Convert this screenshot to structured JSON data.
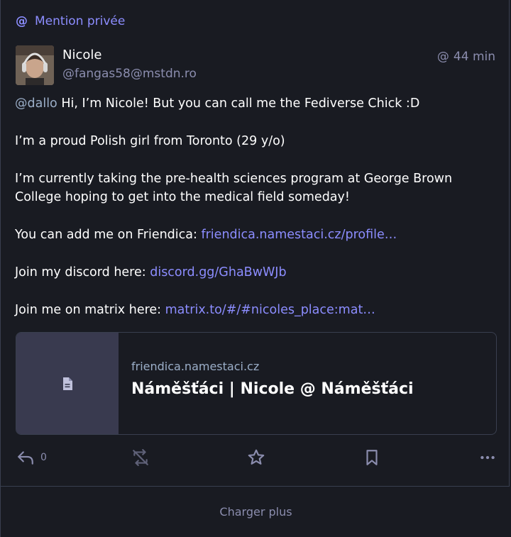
{
  "prepend": {
    "icon": "at-icon",
    "label": "Mention privée"
  },
  "author": {
    "display_name": "Nicole",
    "acct": "@fangas58@mstdn.ro"
  },
  "timestamp": "44 min",
  "content": {
    "mention": "@dallo",
    "line1": " Hi, I’m Nicole! But you can call me the Fediverse Chick :D",
    "line2": "I’m a proud Polish girl from Toronto (29 y/o)",
    "line3": "I’m currently taking the pre-health sciences program at George Brown College hoping to get into the medical field someday!",
    "line4_prefix": "You can add me on Friendica: ",
    "line4_link": "friendica.namestaci.cz/profile…",
    "line5_prefix": "Join my discord here: ",
    "line5_link": "discord.gg/GhaBwWJb",
    "line6_prefix": "Join me on matrix here: ",
    "line6_link": "matrix.to/#/#nicoles_place:mat…"
  },
  "card": {
    "icon": "document-icon",
    "host": "friendica.namestaci.cz",
    "title": "Náměšťáci | Nicole @ Náměšťáci"
  },
  "actions": {
    "reply_count": "0",
    "icons": [
      "reply-icon",
      "boost-disabled-icon",
      "star-icon",
      "bookmark-icon",
      "more-icon"
    ]
  },
  "load_more": "Charger plus",
  "colors": {
    "accent": "#8c8dff",
    "background": "#191b22",
    "muted": "#8b8dae"
  }
}
